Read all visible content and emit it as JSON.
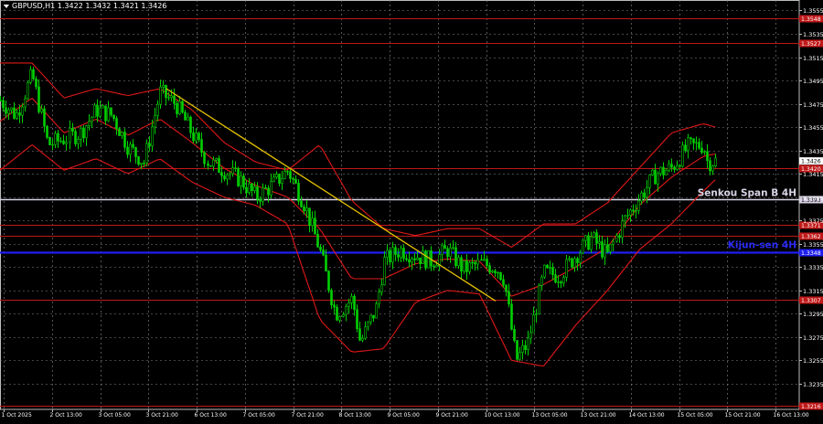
{
  "window": {
    "title": "GBPUSD,H1  1.3422 1.3432 1.3421 1.3426"
  },
  "chart_data": {
    "type": "candlestick",
    "symbol": "GBPUSD",
    "timeframe": "H1",
    "ohlc_header": {
      "open": 1.3422,
      "high": 1.3432,
      "low": 1.3421,
      "close": 1.3426
    },
    "ylim": [
      1.3213,
      1.3564
    ],
    "y_ticks": [
      "1.3555",
      "1.3535",
      "1.3515",
      "1.3495",
      "1.3475",
      "1.3455",
      "1.3435",
      "1.3415",
      "1.3395",
      "1.3375",
      "1.3355",
      "1.3335",
      "1.3315",
      "1.3295",
      "1.3275",
      "1.3255",
      "1.3235"
    ],
    "x_labels": [
      "1 Oct 2025",
      "2 Oct 13:00",
      "3 Oct 05:00",
      "3 Oct 21:00",
      "6 Oct 13:00",
      "7 Oct 05:00",
      "7 Oct 21:00",
      "8 Oct 13:00",
      "9 Oct 05:00",
      "9 Oct 21:00",
      "10 Oct 13:00",
      "13 Oct 05:00",
      "13 Oct 21:00",
      "14 Oct 13:00",
      "15 Oct 05:00",
      "15 Oct 21:00",
      "16 Oct 13:00"
    ],
    "current_price": "1.3426",
    "levels": [
      {
        "price": 1.3548,
        "label": "1.3548",
        "color": "#c01818",
        "kind": "level"
      },
      {
        "price": 1.3527,
        "label": "1.3527",
        "color": "#c01818",
        "kind": "level"
      },
      {
        "price": 1.342,
        "label": "1.3420",
        "color": "#c01818",
        "kind": "level"
      },
      {
        "price": 1.3393,
        "label": "1.3393",
        "color": "#d9d3e6",
        "kind": "senkou"
      },
      {
        "price": 1.3371,
        "label": "1.3371",
        "color": "#c01818",
        "kind": "level"
      },
      {
        "price": 1.3362,
        "label": "1.3362",
        "color": "#c01818",
        "kind": "level"
      },
      {
        "price": 1.3348,
        "label": "1.3348",
        "color": "#1e1ef0",
        "kind": "kijun"
      },
      {
        "price": 1.3307,
        "label": "1.3307",
        "color": "#c01818",
        "kind": "level"
      },
      {
        "price": 1.3216,
        "label": "1.3216",
        "color": "#c01818",
        "kind": "level"
      }
    ],
    "annotations": [
      {
        "text": "Senkou Span B 4H",
        "price": 1.3393,
        "color": "#d9d3e6"
      },
      {
        "text": "Kijun-sen 4H",
        "price": 1.3348,
        "color": "#2a2af5"
      }
    ],
    "trendline": {
      "from": {
        "x": 0.208,
        "price": 1.3488
      },
      "to": {
        "x": 0.62,
        "price": 1.3306
      },
      "color": "#e6c200"
    },
    "close_path": [
      [
        0.0,
        1.3478
      ],
      [
        0.02,
        1.3465
      ],
      [
        0.04,
        1.35
      ],
      [
        0.06,
        1.344
      ],
      [
        0.08,
        1.3445
      ],
      [
        0.1,
        1.345
      ],
      [
        0.12,
        1.347
      ],
      [
        0.14,
        1.3465
      ],
      [
        0.16,
        1.3438
      ],
      [
        0.18,
        1.3425
      ],
      [
        0.2,
        1.3485
      ],
      [
        0.22,
        1.3475
      ],
      [
        0.24,
        1.345
      ],
      [
        0.26,
        1.3425
      ],
      [
        0.28,
        1.3418
      ],
      [
        0.3,
        1.341
      ],
      [
        0.32,
        1.3395
      ],
      [
        0.34,
        1.3405
      ],
      [
        0.36,
        1.3418
      ],
      [
        0.38,
        1.339
      ],
      [
        0.4,
        1.335
      ],
      [
        0.42,
        1.3295
      ],
      [
        0.44,
        1.3308
      ],
      [
        0.45,
        1.327
      ],
      [
        0.47,
        1.33
      ],
      [
        0.48,
        1.334
      ],
      [
        0.5,
        1.335
      ],
      [
        0.52,
        1.3345
      ],
      [
        0.54,
        1.334
      ],
      [
        0.56,
        1.335
      ],
      [
        0.58,
        1.3333
      ],
      [
        0.6,
        1.3338
      ],
      [
        0.62,
        1.3335
      ],
      [
        0.63,
        1.3325
      ],
      [
        0.645,
        1.3255
      ],
      [
        0.66,
        1.327
      ],
      [
        0.68,
        1.333
      ],
      [
        0.7,
        1.3328
      ],
      [
        0.72,
        1.3345
      ],
      [
        0.74,
        1.336
      ],
      [
        0.76,
        1.3345
      ],
      [
        0.78,
        1.3375
      ],
      [
        0.8,
        1.3395
      ],
      [
        0.82,
        1.3415
      ],
      [
        0.84,
        1.342
      ],
      [
        0.86,
        1.3438
      ],
      [
        0.88,
        1.344
      ],
      [
        0.885,
        1.3425
      ],
      [
        0.895,
        1.3426
      ]
    ],
    "bollinger": {
      "color": "#e01818",
      "upper": [
        [
          0.0,
          1.351
        ],
        [
          0.04,
          1.351
        ],
        [
          0.08,
          1.348
        ],
        [
          0.12,
          1.3488
        ],
        [
          0.16,
          1.3482
        ],
        [
          0.2,
          1.3488
        ],
        [
          0.24,
          1.347
        ],
        [
          0.28,
          1.3442
        ],
        [
          0.32,
          1.3425
        ],
        [
          0.36,
          1.3418
        ],
        [
          0.4,
          1.344
        ],
        [
          0.44,
          1.3392
        ],
        [
          0.48,
          1.3368
        ],
        [
          0.52,
          1.3362
        ],
        [
          0.56,
          1.3368
        ],
        [
          0.6,
          1.3368
        ],
        [
          0.64,
          1.3352
        ],
        [
          0.68,
          1.3372
        ],
        [
          0.72,
          1.3372
        ],
        [
          0.76,
          1.339
        ],
        [
          0.8,
          1.342
        ],
        [
          0.84,
          1.345
        ],
        [
          0.88,
          1.3458
        ],
        [
          0.895,
          1.3455
        ]
      ],
      "middle": [
        [
          0.0,
          1.346
        ],
        [
          0.04,
          1.348
        ],
        [
          0.08,
          1.345
        ],
        [
          0.12,
          1.3462
        ],
        [
          0.16,
          1.3448
        ],
        [
          0.2,
          1.3462
        ],
        [
          0.24,
          1.3442
        ],
        [
          0.28,
          1.342
        ],
        [
          0.32,
          1.3405
        ],
        [
          0.36,
          1.3395
        ],
        [
          0.4,
          1.3368
        ],
        [
          0.44,
          1.3325
        ],
        [
          0.48,
          1.3325
        ],
        [
          0.52,
          1.3338
        ],
        [
          0.56,
          1.3342
        ],
        [
          0.6,
          1.334
        ],
        [
          0.64,
          1.331
        ],
        [
          0.68,
          1.332
        ],
        [
          0.72,
          1.3335
        ],
        [
          0.76,
          1.3352
        ],
        [
          0.8,
          1.3388
        ],
        [
          0.84,
          1.3412
        ],
        [
          0.88,
          1.343
        ],
        [
          0.895,
          1.3432
        ]
      ],
      "lower": [
        [
          0.0,
          1.3418
        ],
        [
          0.04,
          1.344
        ],
        [
          0.08,
          1.3418
        ],
        [
          0.12,
          1.3428
        ],
        [
          0.16,
          1.3415
        ],
        [
          0.2,
          1.3428
        ],
        [
          0.24,
          1.3408
        ],
        [
          0.28,
          1.3395
        ],
        [
          0.32,
          1.3388
        ],
        [
          0.36,
          1.3372
        ],
        [
          0.4,
          1.329
        ],
        [
          0.44,
          1.3262
        ],
        [
          0.48,
          1.3265
        ],
        [
          0.52,
          1.3305
        ],
        [
          0.56,
          1.3315
        ],
        [
          0.6,
          1.3312
        ],
        [
          0.64,
          1.3255
        ],
        [
          0.68,
          1.325
        ],
        [
          0.72,
          1.3285
        ],
        [
          0.76,
          1.3315
        ],
        [
          0.8,
          1.335
        ],
        [
          0.84,
          1.3372
        ],
        [
          0.88,
          1.34
        ],
        [
          0.895,
          1.341
        ]
      ]
    },
    "candle_color": "#00d000",
    "grid": true
  }
}
